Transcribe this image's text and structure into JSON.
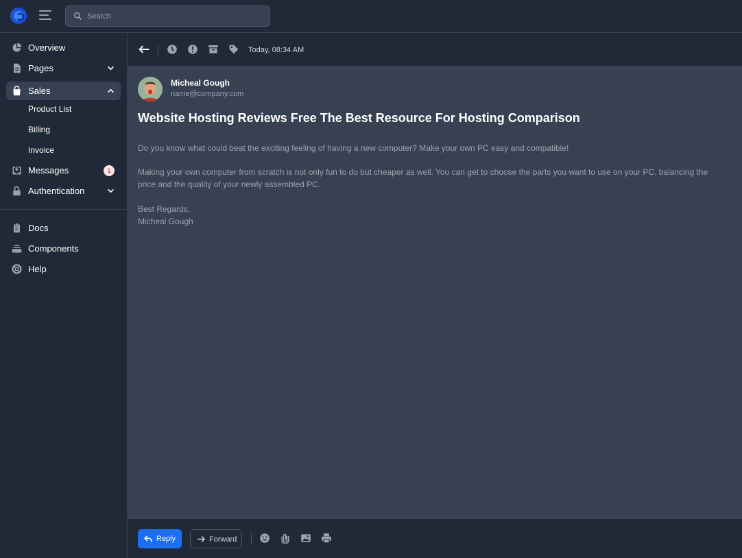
{
  "search": {
    "placeholder": "Search"
  },
  "sidebar": {
    "items": [
      {
        "label": "Overview"
      },
      {
        "label": "Pages"
      },
      {
        "label": "Sales"
      },
      {
        "label": "Messages",
        "badge": "1"
      },
      {
        "label": "Authentication"
      }
    ],
    "sales_subitems": [
      {
        "label": "Product List"
      },
      {
        "label": "Billing"
      },
      {
        "label": "Invoice"
      }
    ],
    "bottom_items": [
      {
        "label": "Docs"
      },
      {
        "label": "Components"
      },
      {
        "label": "Help"
      }
    ]
  },
  "toolbar": {
    "date": "Today, 08:34 AM",
    "icons": [
      "back-arrow-icon",
      "clock-icon",
      "exclamation-icon",
      "archive-icon",
      "tag-icon"
    ]
  },
  "email": {
    "sender_name": "Micheal Gough",
    "sender_email": "name@company.com",
    "subject": "Website Hosting Reviews Free The Best Resource For Hosting Comparison",
    "paragraphs": [
      "Do you know what could beat the exciting feeling of having a new computer? Make your own PC easy and compatible!",
      "Making your own computer from scratch is not only fun to do but cheaper as well. You can get to choose the parts you want to use on your PC. balancing the price and the quality of your newly assembled PC.",
      "Best Regards,",
      "Micheal Gough"
    ]
  },
  "footer": {
    "reply_label": "Reply",
    "forward_label": "Forward",
    "icons": [
      "emoji-icon",
      "paperclip-icon",
      "image-icon",
      "printer-icon"
    ]
  },
  "colors": {
    "background": "#1f2937",
    "content": "#374151",
    "accent": "#1d6ff2",
    "badge_bg": "#fee2e2",
    "badge_text": "#b91c1c"
  }
}
